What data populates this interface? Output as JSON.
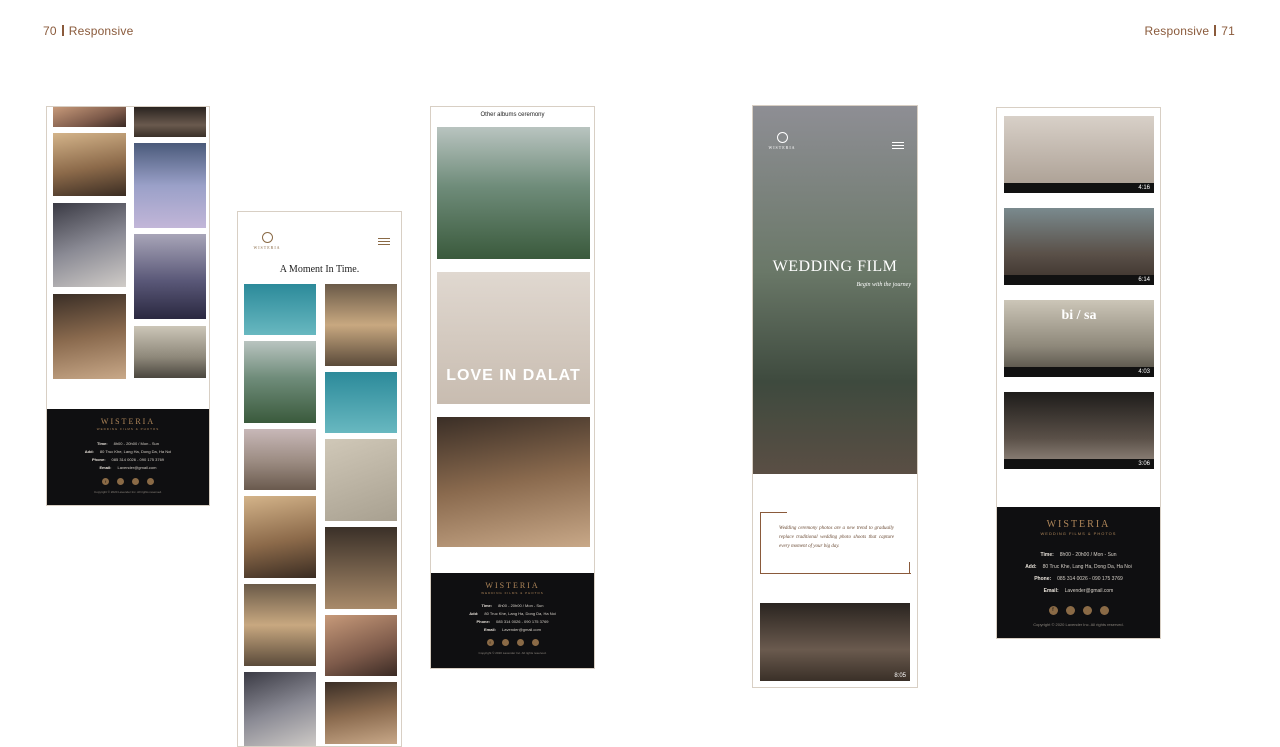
{
  "pages": {
    "left_num": "70",
    "left_label": "Responsive",
    "right_label": "Responsive",
    "right_num": "71"
  },
  "brand": {
    "name": "WISTERIA",
    "tagline": "WEDDING FILMS & PHOTOS"
  },
  "footer": {
    "time_label": "Time:",
    "time_value": "8h00 - 20h00  /  Mon - Sun",
    "add_label": "Add:",
    "add_value": "80 Truc Khe, Lang Ha, Dong Da, Ha Noi",
    "phone_label": "Phone:",
    "phone_value": "085 314 0026  -  090 175 3769",
    "email_label": "Email:",
    "email_value": "Lavender@gmail.com",
    "copyright": "Copyright © 2020 Lavender Inc. All rights reserved."
  },
  "frame2": {
    "heading": "A Moment In Time."
  },
  "frame3": {
    "heading": "Other albums ceremony",
    "overlay": "LOVE IN DALAT"
  },
  "frame4": {
    "hero_title": "WEDDING FILM",
    "hero_script": "Begin with the journey",
    "quote": "Wedding ceremony photos are a new trend to gradually replace traditional wedding photo shoots that capture every moment of your big day.",
    "video_duration": "8:05"
  },
  "frame5": {
    "durations": [
      "4:16",
      "6:14",
      "4:03",
      "3:06"
    ],
    "overlay": "bi / sa"
  },
  "colors": {
    "accent": "#8a5a3b",
    "gold": "#b0875a",
    "footer_bg": "#0f0f11",
    "border": "#d8cfc4"
  }
}
